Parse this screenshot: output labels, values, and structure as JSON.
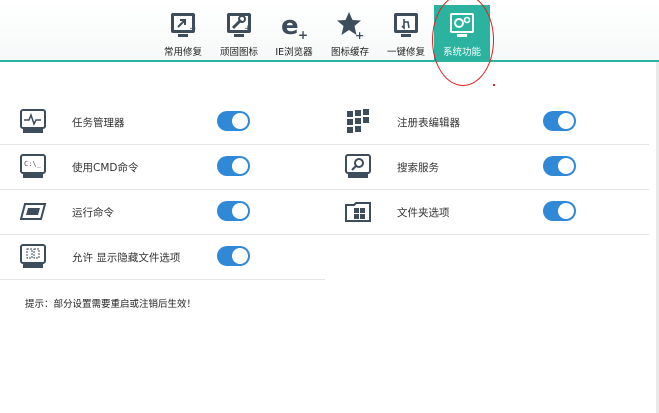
{
  "toolbar": {
    "tabs": [
      {
        "label": "常用修复",
        "icon": "arrow-monitor-icon"
      },
      {
        "label": "顽固图标",
        "icon": "wrench-plus-icon"
      },
      {
        "label": "IE浏览器",
        "icon": "ie-plus-icon"
      },
      {
        "label": "图标缓存",
        "icon": "star-plus-icon"
      },
      {
        "label": "一键修复",
        "icon": "hand-click-icon"
      },
      {
        "label": "系统功能",
        "icon": "gears-monitor-icon",
        "active": true
      }
    ]
  },
  "features": {
    "left": [
      {
        "label": "任务管理器",
        "icon": "task-manager-icon",
        "enabled": true
      },
      {
        "label": "使用CMD命令",
        "icon": "cmd-icon",
        "enabled": true
      },
      {
        "label": "运行命令",
        "icon": "run-icon",
        "enabled": true
      },
      {
        "label": "允许 显示隐藏文件选项",
        "icon": "hidden-files-icon",
        "enabled": true
      }
    ],
    "right": [
      {
        "label": "注册表编辑器",
        "icon": "registry-icon",
        "enabled": true
      },
      {
        "label": "搜索服务",
        "icon": "search-service-icon",
        "enabled": true
      },
      {
        "label": "文件夹选项",
        "icon": "folder-options-icon",
        "enabled": true
      }
    ]
  },
  "hint": "提示：部分设置需要重启或注销后生效！",
  "colors": {
    "accent": "#2bb3a0",
    "toggle_on": "#3089d6",
    "annotation": "#e0201e"
  }
}
